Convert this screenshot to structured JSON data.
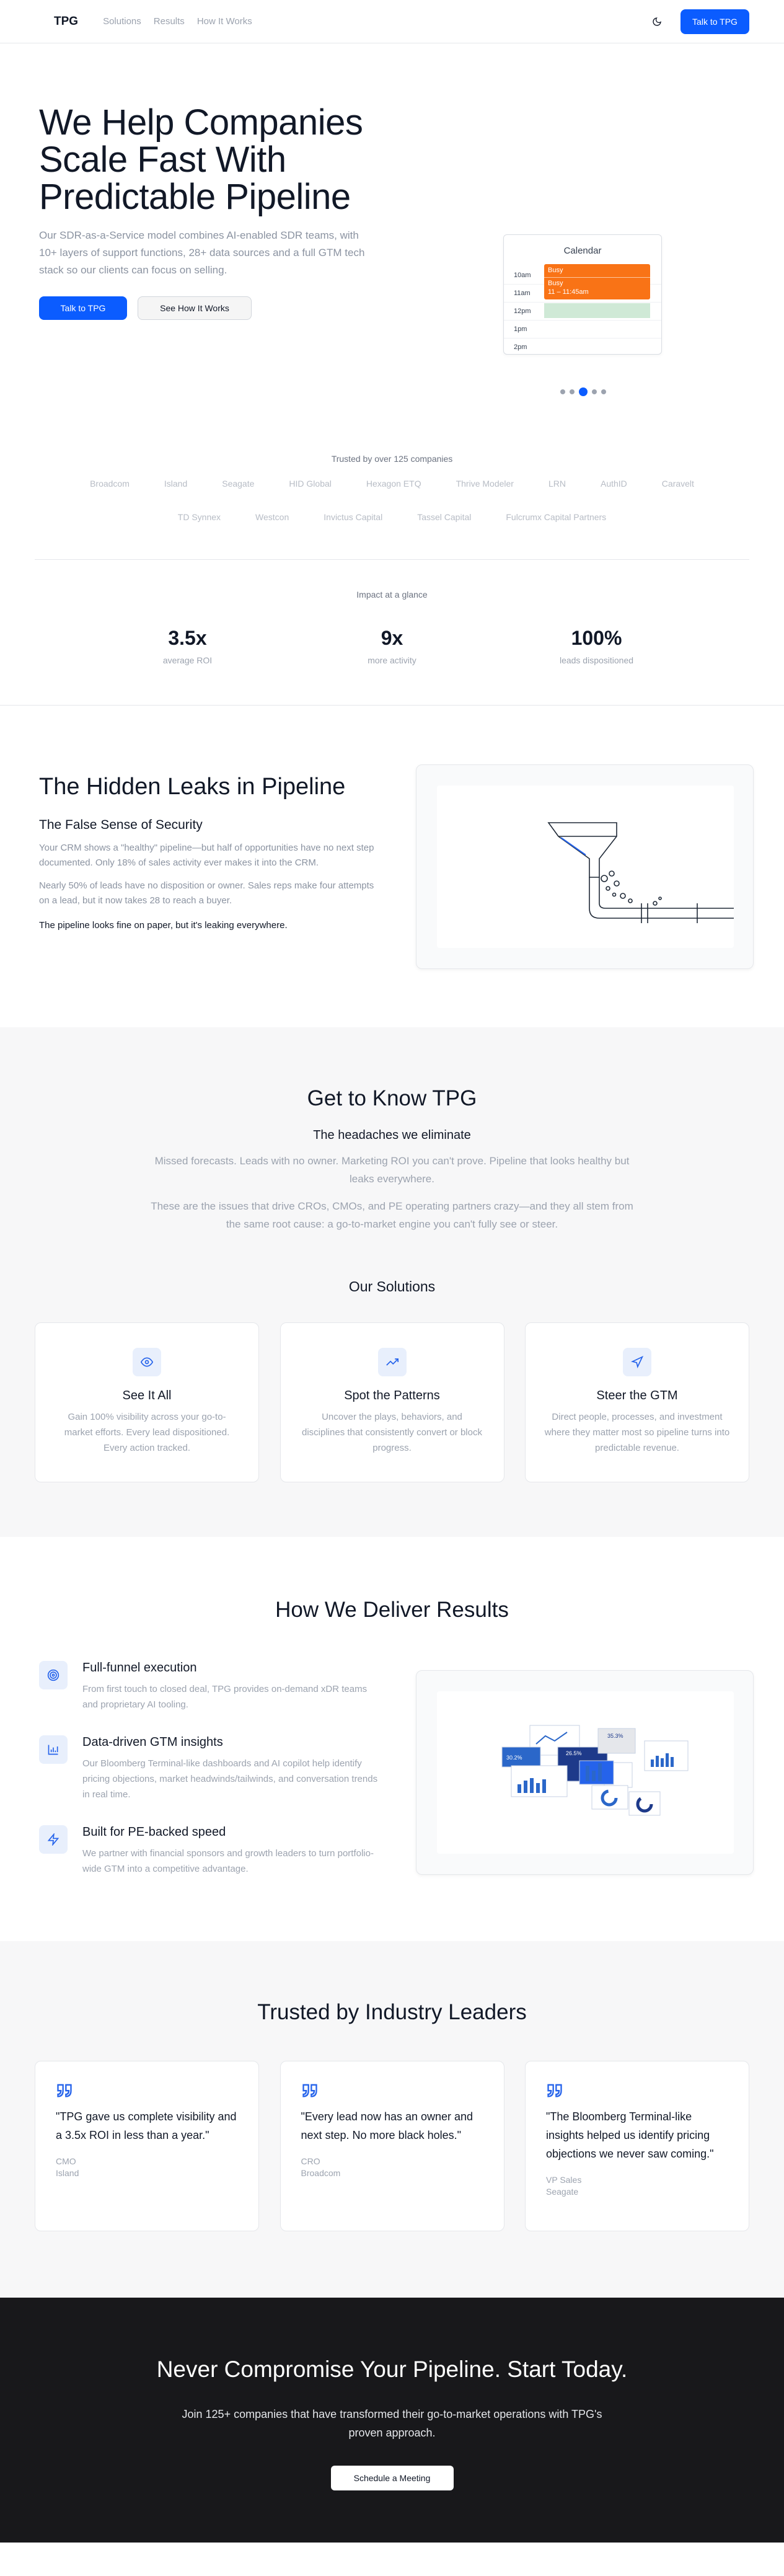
{
  "nav": {
    "logo": "TPG",
    "links": [
      "Solutions",
      "Results",
      "How It Works"
    ],
    "cta": "Talk to TPG"
  },
  "hero": {
    "title": "We Help Companies Scale Fast With Predictable Pipeline",
    "subtitle": "Our SDR-as-a-Service model combines AI-enabled SDR teams, with 10+ layers of support functions, 28+ data sources and a full GTM tech stack so our clients can focus on selling.",
    "primary_cta": "Talk to TPG",
    "secondary_cta": "See How It Works",
    "calendar": {
      "title": "Calendar",
      "times": [
        "10am",
        "11am",
        "12pm",
        "1pm",
        "2pm"
      ],
      "busy_label_1": "Busy",
      "busy_label_2": "Busy",
      "busy_time": "11 – 11:45am",
      "colors": {
        "busy": "#f97316",
        "free": "#cfe9d6"
      }
    },
    "carousel_active_index": 2
  },
  "trusted": {
    "title": "Trusted by over 125 companies",
    "logos": [
      "Broadcom",
      "Island",
      "Seagate",
      "HID Global",
      "Hexagon ETQ",
      "Thrive Modeler",
      "LRN",
      "AuthID",
      "Caravelt",
      "TD Synnex",
      "Westcon",
      "Invictus Capital",
      "Tassel Capital",
      "Fulcrumx Capital Partners"
    ]
  },
  "impact": {
    "title": "Impact at a glance",
    "stats": [
      {
        "value": "3.5x",
        "label": "average ROI"
      },
      {
        "value": "9x",
        "label": "more activity"
      },
      {
        "value": "100%",
        "label": "leads dispositioned"
      }
    ]
  },
  "leaks": {
    "title": "The Hidden Leaks in Pipeline",
    "subtitle": "The False Sense of Security",
    "p1": "Your CRM shows a \"healthy\" pipeline—but half of opportunities have no next step documented. Only 18% of sales activity ever makes it into the CRM.",
    "p2": "Nearly 50% of leads have no disposition or owner. Sales reps make four attempts on a lead, but it now takes 28 to reach a buyer.",
    "p3": "The pipeline looks fine on paper, but it's leaking everywhere."
  },
  "know": {
    "title": "Get to Know TPG",
    "subtitle": "The headaches we eliminate",
    "p1": "Missed forecasts. Leads with no owner. Marketing ROI you can't prove. Pipeline that looks healthy but leaks everywhere.",
    "p2": "These are the issues that drive CROs, CMOs, and PE operating partners crazy—and they all stem from the same root cause: a go-to-market engine you can't fully see or steer.",
    "solutions_title": "Our Solutions",
    "solutions": [
      {
        "icon": "eye-icon",
        "name": "See It All",
        "desc": "Gain 100% visibility across your go-to-market efforts. Every lead dispositioned. Every action tracked."
      },
      {
        "icon": "trending-up-icon",
        "name": "Spot the Patterns",
        "desc": "Uncover the plays, behaviors, and disciplines that consistently convert or block progress."
      },
      {
        "icon": "navigation-icon",
        "name": "Steer the GTM",
        "desc": "Direct people, processes, and investment where they matter most so pipeline turns into predictable revenue."
      }
    ]
  },
  "deliver": {
    "title": "How We Deliver Results",
    "features": [
      {
        "icon": "target-icon",
        "title": "Full-funnel execution",
        "desc": "From first touch to closed deal, TPG provides on-demand xDR teams and proprietary AI tooling."
      },
      {
        "icon": "bar-chart-icon",
        "title": "Data-driven GTM insights",
        "desc": "Our Bloomberg Terminal-like dashboards and AI copilot help identify pricing objections, market headwinds/tailwinds, and conversation trends in real time."
      },
      {
        "icon": "zap-icon",
        "title": "Built for PE-backed speed",
        "desc": "We partner with financial sponsors and growth leaders to turn portfolio-wide GTM into a competitive advantage."
      }
    ],
    "dashboard_labels": [
      "26.5%",
      "30.2%",
      "35.3%"
    ]
  },
  "testimonials": {
    "title": "Trusted by Industry Leaders",
    "items": [
      {
        "quote": "\"TPG gave us complete visibility and a 3.5x ROI in less than a year.\"",
        "role": "CMO",
        "company": "Island"
      },
      {
        "quote": "\"Every lead now has an owner and next step. No more black holes.\"",
        "role": "CRO",
        "company": "Broadcom"
      },
      {
        "quote": "\"The Bloomberg Terminal-like insights helped us identify pricing objections we never saw coming.\"",
        "role": "VP Sales",
        "company": "Seagate"
      }
    ]
  },
  "cta": {
    "title": "Never Compromise Your Pipeline. Start Today.",
    "subtitle": "Join 125+ companies that have transformed their go-to-market operations with TPG's proven approach.",
    "button": "Schedule a Meeting"
  },
  "colors": {
    "accent": "#0b5cff",
    "dark": "#18181b",
    "soft_bg": "#f7f7f8"
  }
}
